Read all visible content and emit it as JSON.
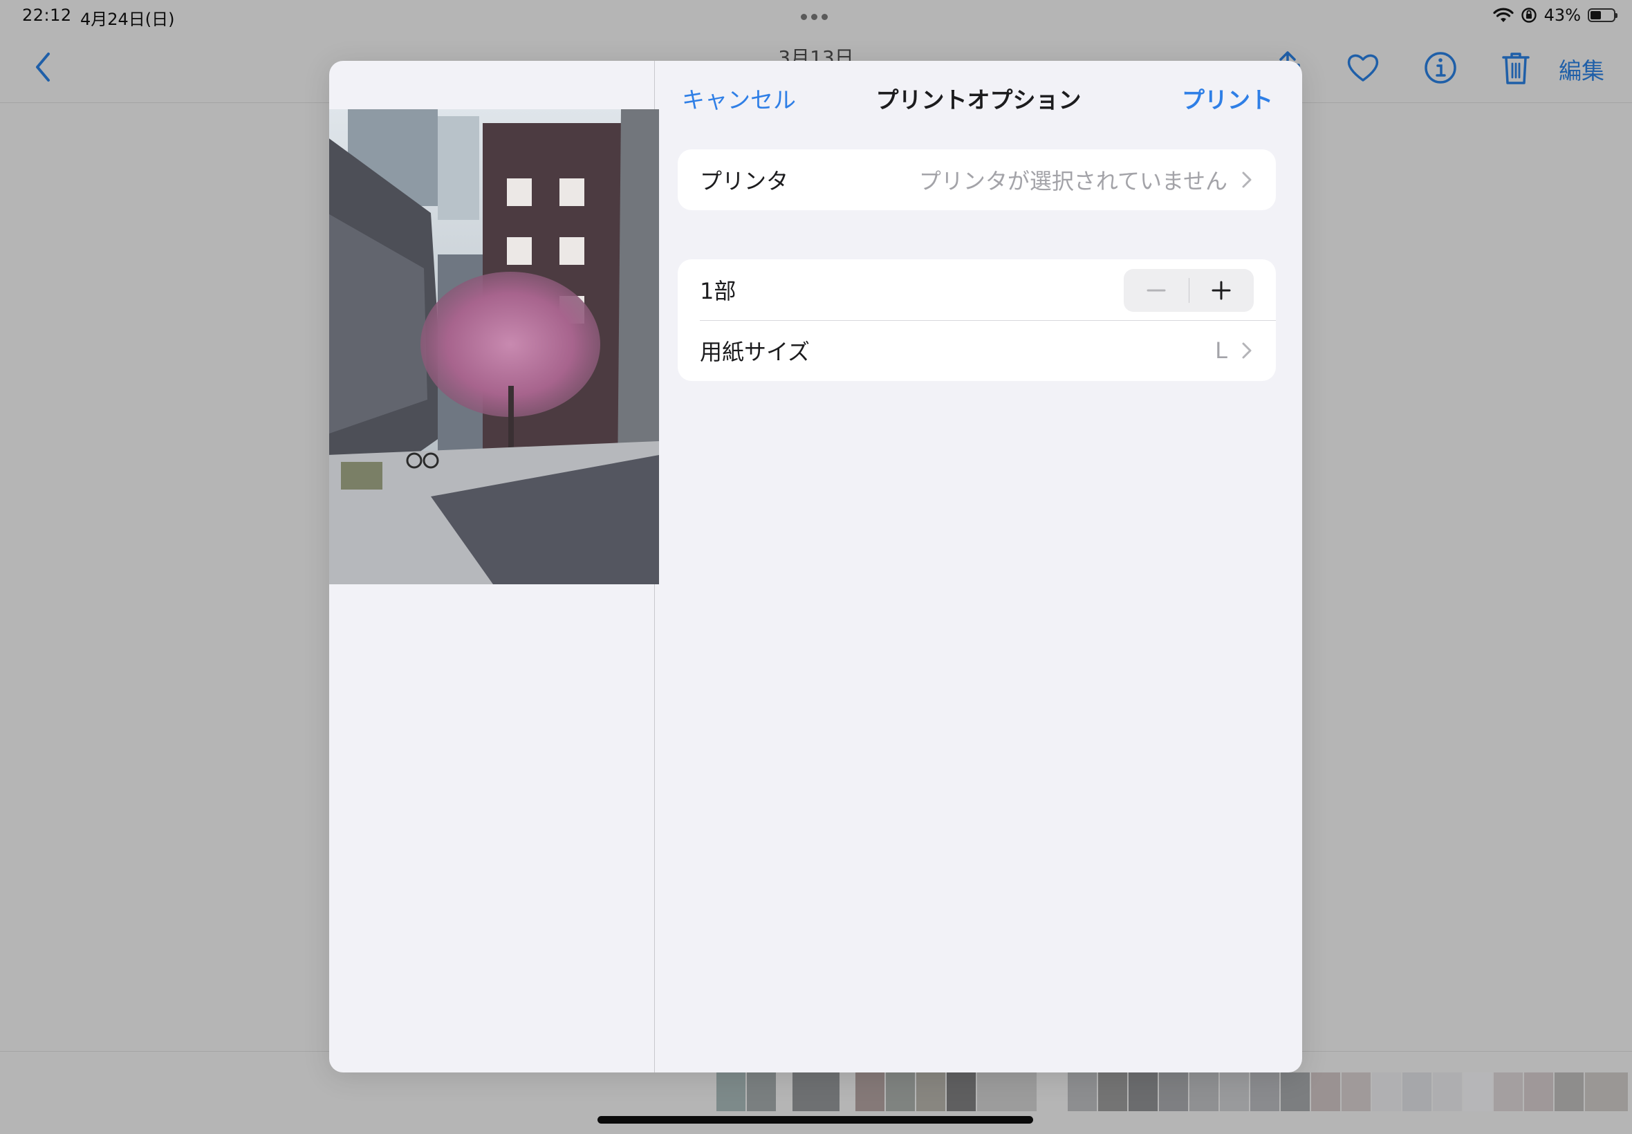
{
  "status_bar": {
    "time": "22:12",
    "date": "4月24日(日)",
    "battery_percent": "43%"
  },
  "photos_nav": {
    "title": "3月13日",
    "edit_label": "編集"
  },
  "print_sheet": {
    "cancel_label": "キャンセル",
    "title": "プリントオプション",
    "print_label": "プリント",
    "printer_row": {
      "label": "プリンタ",
      "value": "プリンタが選択されていません"
    },
    "copies_row": {
      "label": "1部"
    },
    "paper_size_row": {
      "label": "用紙サイズ",
      "value": "L"
    }
  },
  "colors": {
    "accent": "#2f7fe6",
    "sheet_background": "#f2f2f7",
    "group_background": "#ffffff",
    "secondary_text": "#a3a3a8"
  },
  "icons": {
    "back": "chevron-left-icon",
    "share": "share-icon",
    "favorite": "heart-icon",
    "info": "info-icon",
    "delete": "trash-icon",
    "row_disclosure": "chevron-right-icon",
    "decrement": "minus-icon",
    "increment": "plus-icon"
  }
}
